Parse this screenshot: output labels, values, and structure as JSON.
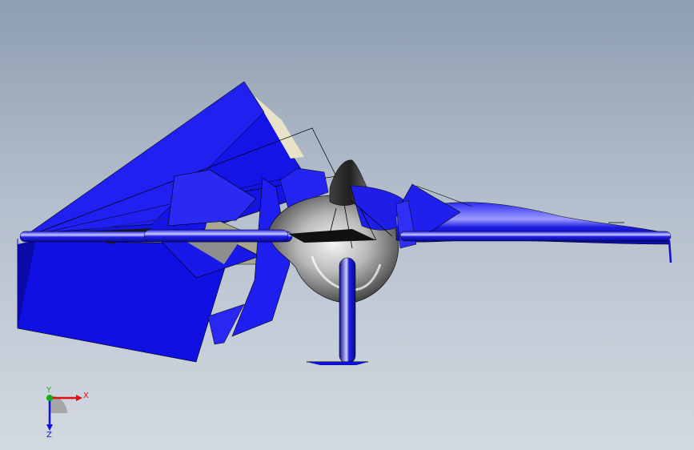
{
  "viewport": {
    "background_top": "#8e9db1",
    "background_bottom": "#d3d9e1"
  },
  "model": {
    "primary_color": "#1010e0",
    "secondary_color": "#c0c0c0",
    "edge_color": "#000000"
  },
  "triad": {
    "x_label": "X",
    "y_label": "Y",
    "z_label": "Z",
    "x_color": "#e01010",
    "y_color": "#10b010",
    "z_color": "#1010e0"
  }
}
